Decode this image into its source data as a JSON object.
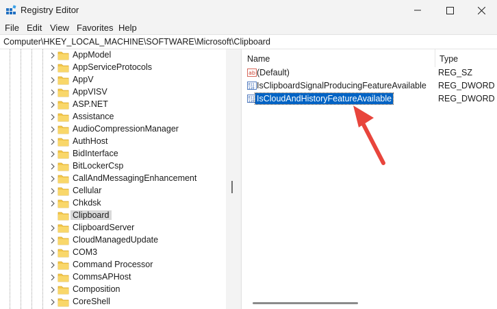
{
  "window": {
    "title": "Registry Editor"
  },
  "menu": [
    "File",
    "Edit",
    "View",
    "Favorites",
    "Help"
  ],
  "address": "Computer\\HKEY_LOCAL_MACHINE\\SOFTWARE\\Microsoft\\Clipboard",
  "tree": {
    "items": [
      {
        "label": "AppModel"
      },
      {
        "label": "AppServiceProtocols"
      },
      {
        "label": "AppV"
      },
      {
        "label": "AppVISV"
      },
      {
        "label": "ASP.NET"
      },
      {
        "label": "Assistance"
      },
      {
        "label": "AudioCompressionManager"
      },
      {
        "label": "AuthHost"
      },
      {
        "label": "BidInterface"
      },
      {
        "label": "BitLockerCsp"
      },
      {
        "label": "CallAndMessagingEnhancement"
      },
      {
        "label": "Cellular"
      },
      {
        "label": "Chkdsk"
      },
      {
        "label": "Clipboard",
        "selected": true
      },
      {
        "label": "ClipboardServer"
      },
      {
        "label": "CloudManagedUpdate"
      },
      {
        "label": "COM3"
      },
      {
        "label": "Command Processor"
      },
      {
        "label": "CommsAPHost"
      },
      {
        "label": "Composition"
      },
      {
        "label": "CoreShell"
      }
    ]
  },
  "values": {
    "headers": {
      "name": "Name",
      "type": "Type"
    },
    "rows": [
      {
        "name": "(Default)",
        "type": "REG_SZ",
        "icon": "ab-string-icon"
      },
      {
        "name": "IsClipboardSignalProducingFeatureAvailable",
        "type": "REG_DWORD",
        "icon": "binary-value-icon"
      },
      {
        "name": "IsCloudAndHistoryFeatureAvailable",
        "type": "REG_DWORD",
        "icon": "binary-value-icon",
        "selected": true
      }
    ]
  },
  "colors": {
    "selection": "#0063c4",
    "folder": "#f4c84a",
    "annotation_arrow": "#e8453c"
  }
}
